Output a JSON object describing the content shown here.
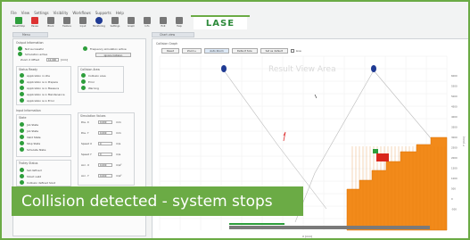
{
  "menu": [
    "File",
    "View",
    "Settings",
    "Visibility",
    "Workflows",
    "Supports",
    "Help"
  ],
  "toolbar": [
    {
      "label": "Reset/Stop",
      "icon": "reset-icon",
      "color": "#2e9e3c"
    },
    {
      "label": "Pause",
      "icon": "pause-icon",
      "color": "#d33"
    },
    {
      "label": "Block",
      "icon": "block-icon",
      "color": "#777"
    },
    {
      "label": "Feature",
      "icon": "feature-icon",
      "color": "#777"
    },
    {
      "label": "Input",
      "icon": "input-icon",
      "color": "#777"
    },
    {
      "label": "Monitoring",
      "icon": "monitoring-icon",
      "color": "#1f3a93"
    },
    {
      "label": "Settings",
      "icon": "settings-icon",
      "color": "#777"
    },
    {
      "label": "Graph",
      "icon": "graph-icon",
      "color": "#777"
    },
    {
      "label": "Info",
      "icon": "info-icon",
      "color": "#777"
    },
    {
      "label": "Exit",
      "icon": "exit-icon",
      "color": "#777"
    },
    {
      "label": "Help",
      "icon": "help-icon",
      "color": "#777"
    }
  ],
  "brand": "LASE",
  "left_tab": "Menu",
  "right_tab": "Chart view",
  "output_info": {
    "title": "Output Information",
    "items": [
      "Not successful",
      "Simulation active"
    ],
    "right_item": "Frequency simulation active",
    "button": "Ignore Collision",
    "zoom_label": "Zoom X Offset",
    "zoom_value": "10.000",
    "zoom_unit": "[mm]"
  },
  "status": {
    "title": "Status Ready",
    "items": [
      "Application in idle",
      "Application is in Prepare",
      "Application is in Measure",
      "Application is in Maintenance",
      "Application is in Error"
    ]
  },
  "collision": {
    "title": "Collision Area",
    "items": [
      "Collision area",
      "Error",
      "Warning"
    ]
  },
  "input_info": {
    "title": "Input Information",
    "subtitle": "State",
    "items": [
      "Job State",
      "Job State",
      "Valid State",
      "Stop State",
      "Simulate State"
    ]
  },
  "trolley": {
    "title": "Trolley Status",
    "items": [
      "Set defined",
      "Shoot valid",
      "Collision defined hoist"
    ]
  },
  "simulation": {
    "title": "Simulation Values",
    "rows": [
      {
        "label": "Pos. X",
        "value": "0.000",
        "unit": "mm"
      },
      {
        "label": "Pos. Y",
        "value": "0.000",
        "unit": "mm"
      },
      {
        "label": "Speed X",
        "value": "0",
        "unit": "m/s"
      },
      {
        "label": "Speed Y",
        "value": "0",
        "unit": "m/s"
      },
      {
        "label": "Acc. X",
        "value": "0.000",
        "unit": "m/s²"
      },
      {
        "label": "Acc. Y",
        "value": "0.000",
        "unit": "m/s²"
      }
    ]
  },
  "autotrolley": {
    "title": "Automatic Trolley"
  },
  "chart": {
    "title": "Collision Graph",
    "buttons": [
      "Reset",
      "Zoom+",
      "Auto Zoom",
      "Default Size",
      "Set as default"
    ],
    "check_label": "Live",
    "watermark": "Result View Area",
    "xlabel": "X [mm]",
    "ylabel": "Y [mm]",
    "yticks": [
      "6000",
      "5500",
      "5000",
      "4500",
      "4000",
      "3500",
      "3000",
      "2500",
      "2000",
      "1500",
      "1000",
      "500",
      "0",
      "-500"
    ]
  },
  "caption": "Collision detected - system stops",
  "colors": {
    "accent": "#6bab45",
    "fill": "#f28a1a",
    "marker": "#1f3a93"
  }
}
